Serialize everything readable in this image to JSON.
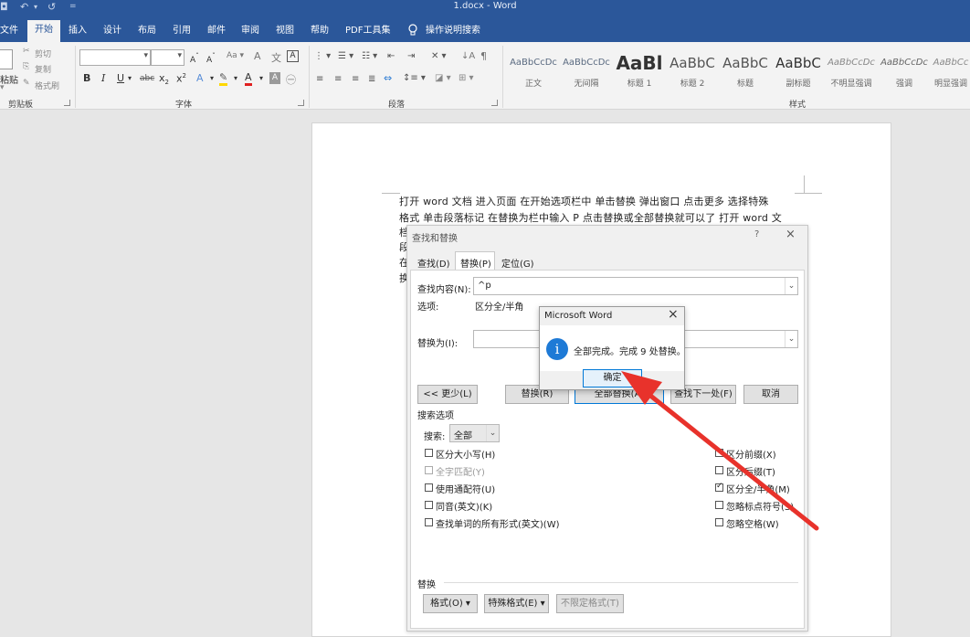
{
  "window": {
    "title": "1.docx  -  Word"
  },
  "tabs": [
    {
      "label": "文件",
      "active": false
    },
    {
      "label": "开始",
      "active": true
    },
    {
      "label": "插入",
      "active": false
    },
    {
      "label": "设计",
      "active": false
    },
    {
      "label": "布局",
      "active": false
    },
    {
      "label": "引用",
      "active": false
    },
    {
      "label": "邮件",
      "active": false
    },
    {
      "label": "审阅",
      "active": false
    },
    {
      "label": "视图",
      "active": false
    },
    {
      "label": "帮助",
      "active": false
    },
    {
      "label": "PDF工具集",
      "active": false
    }
  ],
  "tell_me": "操作说明搜索",
  "ribbon": {
    "clipboard": {
      "paste": "粘贴",
      "cut": "剪切",
      "copy": "复制",
      "format_painter": "格式刷",
      "label": "剪贴板"
    },
    "font": {
      "label": "字体"
    },
    "paragraph": {
      "label": "段落"
    },
    "styles": {
      "label": "样式",
      "items": [
        {
          "preview": "AaBbCcDc",
          "name": "正文"
        },
        {
          "preview": "AaBbCcDc",
          "name": "无间隔"
        },
        {
          "preview": "AaBl",
          "name": "标题 1"
        },
        {
          "preview": "AaBbC",
          "name": "标题 2"
        },
        {
          "preview": "AaBbC",
          "name": "标题"
        },
        {
          "preview": "AaBbC",
          "name": "副标题"
        },
        {
          "preview": "AaBbCcDc",
          "name": "不明显强调"
        },
        {
          "preview": "AaBbCcDc",
          "name": "强调"
        },
        {
          "preview": "AaBbCc",
          "name": "明显强调"
        }
      ]
    }
  },
  "document": {
    "lines": [
      "打开 word 文档   进入页面   在开始选项栏中   单击替换   弹出窗口   点击更多   选择特殊",
      "格式   单击段落标记   在替换为栏中输入 P   点击替换或全部替换就可以了   打开 word 文",
      "档",
      "段",
      "在",
      "换"
    ]
  },
  "find_replace": {
    "title": "查找和替换",
    "help": "?",
    "close": "×",
    "tabs": [
      "查找(D)",
      "替换(P)",
      "定位(G)"
    ],
    "find_label": "查找内容(N):",
    "find_value": "^p",
    "options_label": "选项:",
    "options_value": "区分全/半角",
    "replace_label": "替换为(I):",
    "replace_value": "",
    "buttons": {
      "less": "<< 更少(L)",
      "replace": "替换(R)",
      "replace_all": "全部替换(A)",
      "find_next": "查找下一处(F)",
      "cancel": "取消"
    },
    "search_options_title": "搜索选项",
    "search_label": "搜索:",
    "search_value": "全部",
    "left_options": [
      {
        "label": "区分大小写(H)",
        "checked": false,
        "disabled": false
      },
      {
        "label": "全字匹配(Y)",
        "checked": false,
        "disabled": true
      },
      {
        "label": "使用通配符(U)",
        "checked": false,
        "disabled": false
      },
      {
        "label": "同音(英文)(K)",
        "checked": false,
        "disabled": false
      },
      {
        "label": "查找单词的所有形式(英文)(W)",
        "checked": false,
        "disabled": false
      }
    ],
    "right_options": [
      {
        "label": "区分前缀(X)",
        "checked": false
      },
      {
        "label": "区分后缀(T)",
        "checked": false
      },
      {
        "label": "区分全/半角(M)",
        "checked": true
      },
      {
        "label": "忽略标点符号(S)",
        "checked": false
      },
      {
        "label": "忽略空格(W)",
        "checked": false
      }
    ],
    "replace_section_title": "替换",
    "format_button": "格式(O) ▾",
    "special_button": "特殊格式(E) ▾",
    "no_format_button": "不限定格式(T)"
  },
  "message_box": {
    "title": "Microsoft Word",
    "close": "×",
    "icon": "info-icon",
    "message": "全部完成。完成 9 处替换。",
    "ok": "确定"
  },
  "colors": {
    "word_blue": "#2b579a",
    "arrow_red": "#e8322b",
    "info_blue": "#1e7ad6"
  }
}
